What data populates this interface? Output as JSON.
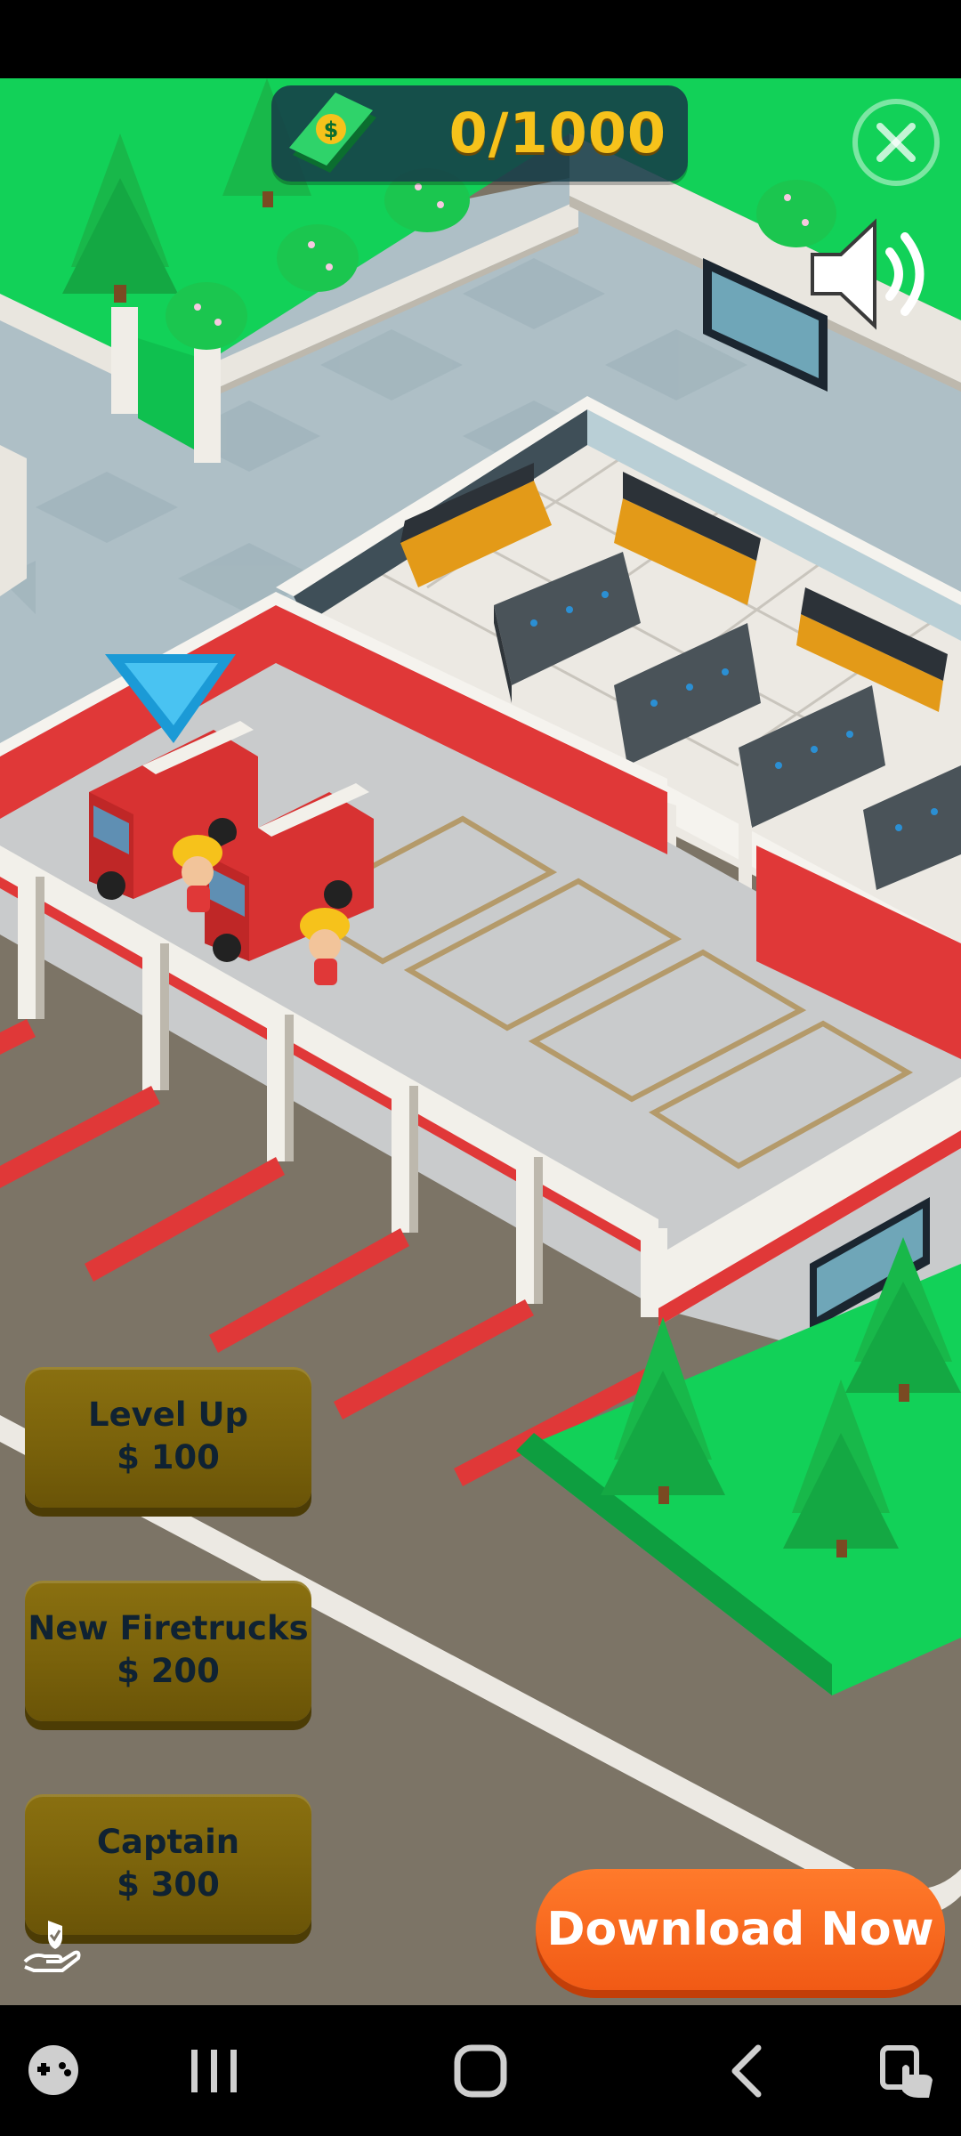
{
  "hud": {
    "money_icon": "cash-bill-icon",
    "money_text": "0/1000",
    "close_icon": "close-x-icon",
    "sound_icon": "speaker-volume-icon"
  },
  "upgrades": [
    {
      "title": "Level Up",
      "price": "$ 100"
    },
    {
      "title": "New Firetrucks",
      "price": "$ 200"
    },
    {
      "title": "Captain",
      "price": "$ 300"
    }
  ],
  "download": {
    "label": "Download Now"
  },
  "ad_icon": "hand-shield-icon",
  "colors": {
    "grass": "#12d158",
    "wall_red": "#e03838",
    "floor": "#c9cbcc",
    "road": "#797163",
    "button_gold": "#7a620b",
    "download_orange": "#f36419",
    "money_yellow": "#f6c21b"
  },
  "nav": {
    "icons": [
      "game-controller-icon",
      "recent-apps-icon",
      "home-icon",
      "back-icon",
      "screen-touch-icon"
    ]
  }
}
